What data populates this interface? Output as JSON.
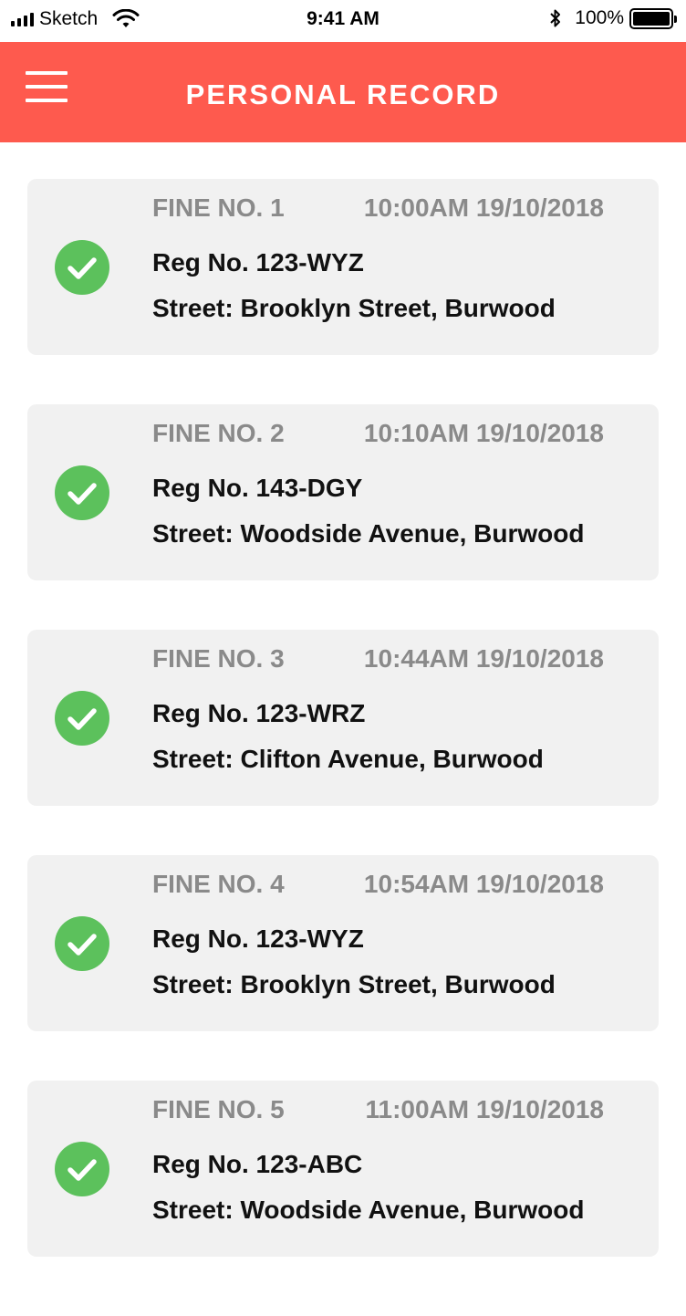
{
  "status_bar": {
    "carrier": "Sketch",
    "time": "9:41 AM",
    "battery": "100%",
    "icons": [
      "signal-icon",
      "wifi-icon",
      "bluetooth-icon",
      "battery-icon"
    ]
  },
  "header": {
    "title": "PERSONAL RECORD",
    "menu_icon": "hamburger-menu-icon",
    "background_color": "#fe5a4e"
  },
  "colors": {
    "check": "#5cc15c",
    "card_background": "#f1f1f1",
    "muted_text": "#8a8a8a"
  },
  "records": [
    {
      "fine_no": "FINE NO. 1",
      "datetime": "10:00AM 19/10/2018",
      "reg": "Reg No. 123-WYZ",
      "street": "Street: Brooklyn Street, Burwood",
      "status_icon": "check-circle-icon"
    },
    {
      "fine_no": "FINE NO. 2",
      "datetime": "10:10AM 19/10/2018",
      "reg": "Reg No. 143-DGY",
      "street": "Street: Woodside Avenue, Burwood",
      "status_icon": "check-circle-icon"
    },
    {
      "fine_no": "FINE NO. 3",
      "datetime": "10:44AM 19/10/2018",
      "reg": "Reg No. 123-WRZ",
      "street": "Street: Clifton Avenue, Burwood",
      "status_icon": "check-circle-icon"
    },
    {
      "fine_no": "FINE NO. 4",
      "datetime": "10:54AM 19/10/2018",
      "reg": "Reg No. 123-WYZ",
      "street": "Street: Brooklyn Street, Burwood",
      "status_icon": "check-circle-icon"
    },
    {
      "fine_no": "FINE NO. 5",
      "datetime": "11:00AM 19/10/2018",
      "reg": "Reg No. 123-ABC",
      "street": "Street: Woodside Avenue, Burwood",
      "status_icon": "check-circle-icon"
    }
  ]
}
